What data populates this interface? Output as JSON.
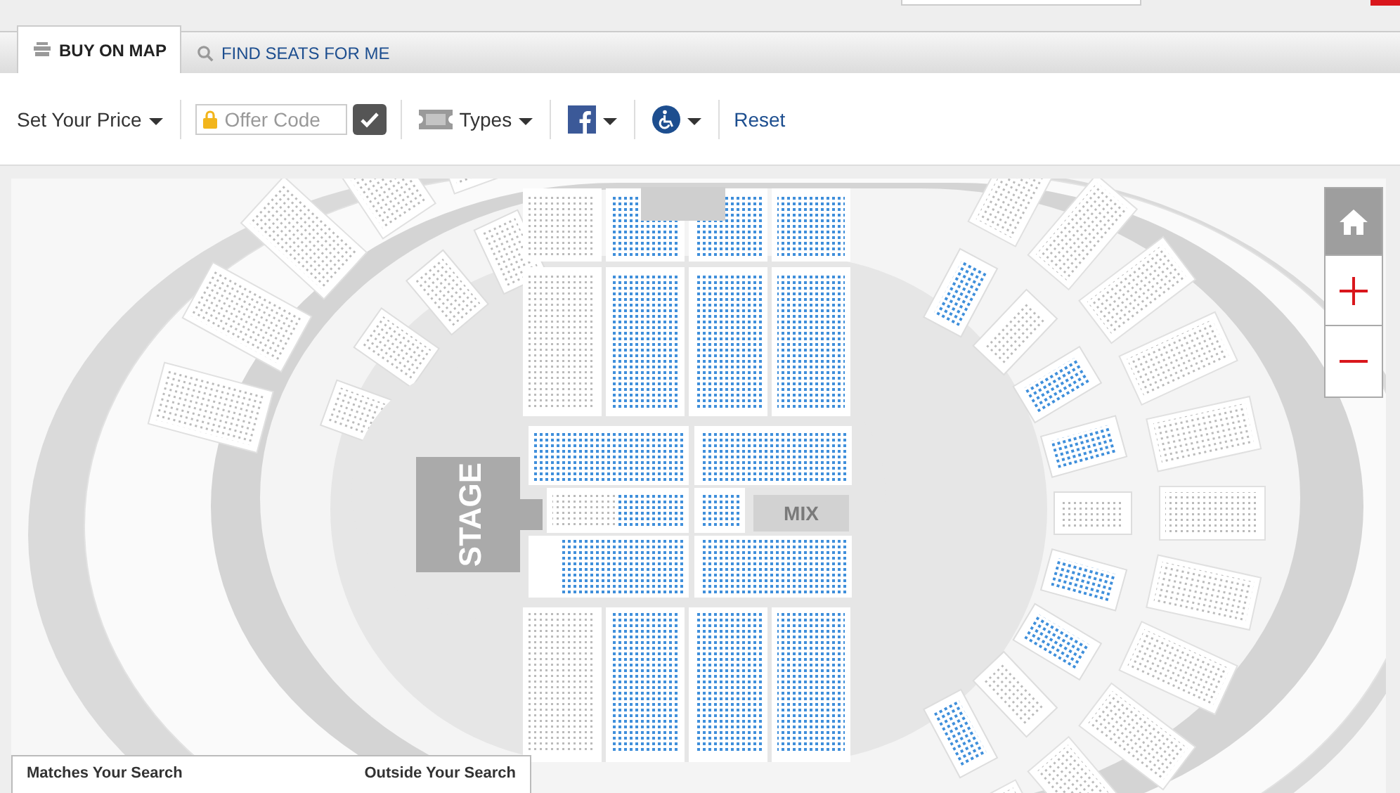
{
  "tabs": [
    {
      "label": "BUY ON MAP",
      "kind": "seats",
      "selected": true
    },
    {
      "label": "FIND SEATS FOR ME",
      "kind": "search",
      "selected": false
    }
  ],
  "toolbar": {
    "price_menu": "Set Your Price",
    "offer_code": {
      "placeholder": "Offer Code"
    },
    "types_menu": "Types",
    "reset": "Reset"
  },
  "map": {
    "stage_label": "STAGE",
    "mix_label": "MIX"
  },
  "legend": {
    "matches": "Matches Your Search",
    "outside": "Outside Your Search"
  }
}
